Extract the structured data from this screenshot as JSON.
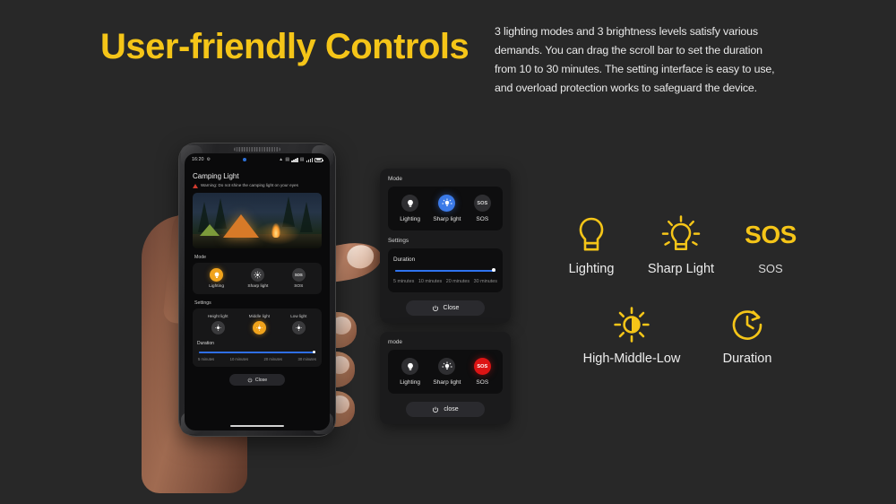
{
  "page": {
    "background_color": "#282828",
    "accent_yellow": "#f5c518",
    "accent_blue": "#3b7ae8",
    "accent_orange": "#f0a31c",
    "accent_red": "#dd1414"
  },
  "header": {
    "title": "User-friendly Controls",
    "description": "3 lighting modes and 3 brightness levels satisfy various demands. You can drag the scroll bar to set the duration from 10 to 30 minutes. The setting interface is easy to use, and overload protection works to safeguard the device."
  },
  "phone": {
    "status_bar": {
      "time": "16:20",
      "battery_label": ""
    },
    "app_title": "Camping Light",
    "warning": "Warning: Do not shine the camping light on your eyes",
    "mode_label": "Mode",
    "modes": [
      {
        "label": "Lighting",
        "icon": "bulb-icon",
        "state": "active"
      },
      {
        "label": "Sharp light",
        "icon": "sharp-bulb-icon",
        "state": "inactive"
      },
      {
        "label": "SOS",
        "icon": "sos-text-icon",
        "state": "inactive"
      }
    ],
    "settings_label": "Settings",
    "brightness": [
      {
        "label": "Height light",
        "state": "inactive"
      },
      {
        "label": "Middle light",
        "state": "active"
      },
      {
        "label": "Low light",
        "state": "inactive"
      }
    ],
    "duration_label": "Duration",
    "duration_ticks": [
      "5 minutes",
      "10 minutes",
      "20 minutes",
      "30 minutes"
    ],
    "duration_value_percent": 100,
    "close_label": "Close"
  },
  "card1": {
    "mode_label": "Mode",
    "modes": [
      {
        "label": "Lighting",
        "icon": "bulb-icon",
        "state": "inactive"
      },
      {
        "label": "Sharp light",
        "icon": "sharp-bulb-icon",
        "state": "active"
      },
      {
        "label": "SOS",
        "icon": "sos-text-icon",
        "state": "inactive"
      }
    ],
    "sos_glyph": "SOS",
    "settings_label": "Settings",
    "duration_label": "Duration",
    "duration_ticks": [
      "5 minutes",
      "10 minutes",
      "20 minutes",
      "30 minutes"
    ],
    "duration_value_percent": 100,
    "close_label": "Close"
  },
  "card2": {
    "mode_label": "mode",
    "modes": [
      {
        "label": "Lighting",
        "icon": "bulb-icon",
        "state": "inactive"
      },
      {
        "label": "Sharp light",
        "icon": "sharp-bulb-icon",
        "state": "inactive"
      },
      {
        "label": "SOS",
        "icon": "sos-text-icon",
        "state": "active"
      }
    ],
    "sos_glyph": "SOS",
    "close_label": "close"
  },
  "features": {
    "row1": [
      {
        "caption": "Lighting",
        "icon": "bulb-outline-icon"
      },
      {
        "caption": "Sharp Light",
        "icon": "bulb-rays-icon"
      },
      {
        "caption": "SOS",
        "icon": "sos-text-icon",
        "glyph": "SOS"
      }
    ],
    "row2": [
      {
        "caption": "High-Middle-Low",
        "icon": "brightness-sun-icon"
      },
      {
        "caption": "Duration",
        "icon": "clock-arrow-icon"
      }
    ]
  }
}
